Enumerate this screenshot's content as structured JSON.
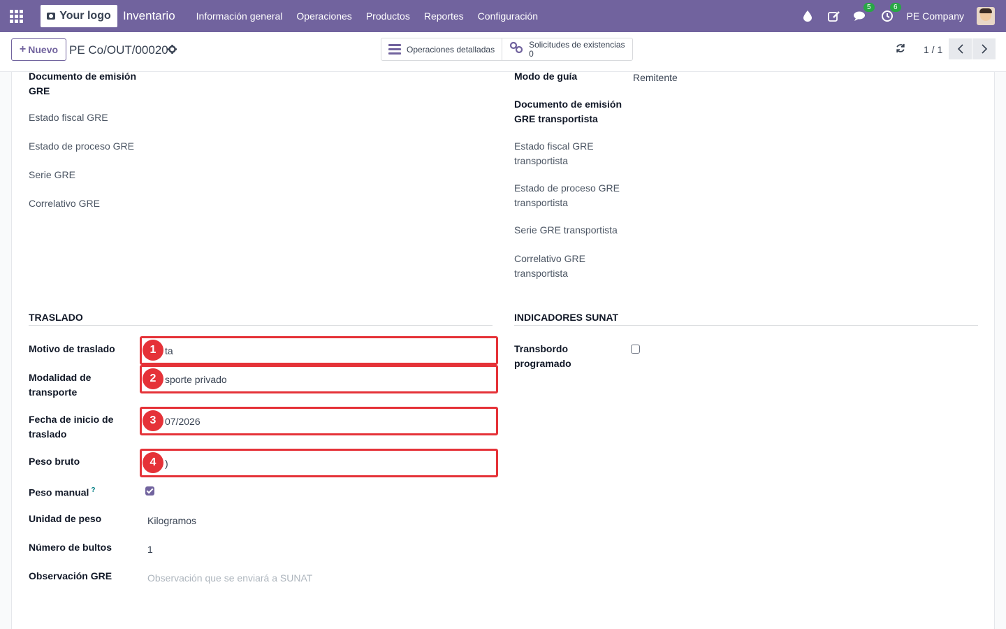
{
  "navbar": {
    "logo_text": "Your logo",
    "app_name": "Inventario",
    "menu": [
      "Información general",
      "Operaciones",
      "Productos",
      "Reportes",
      "Configuración"
    ],
    "messages_badge": "5",
    "activities_badge": "6",
    "company": "PE Company"
  },
  "control": {
    "new_label": "Nuevo",
    "record_name": "PE Co/OUT/00020",
    "smart_detailed": "Operaciones detalladas",
    "smart_requests_label": "Solicitudes de existencias",
    "smart_requests_count": "0",
    "pager": "1 / 1"
  },
  "left_fields": {
    "doc_emision_1": "Documento de emisión",
    "doc_emision_2": "GRE",
    "estado_fiscal": "Estado fiscal GRE",
    "estado_proceso": "Estado de proceso GRE",
    "serie": "Serie GRE",
    "correlativo": "Correlativo GRE"
  },
  "right_fields": {
    "modo_guia": "Modo de guía",
    "modo_guia_value": "Remitente",
    "doc_trans_1": "Documento de emisión",
    "doc_trans_2": "GRE transportista",
    "estado_fiscal_1": "Estado fiscal GRE",
    "estado_fiscal_2": "transportista",
    "estado_proceso_1": "Estado de proceso GRE",
    "estado_proceso_2": "transportista",
    "serie_trans": "Serie GRE transportista",
    "correlativo_1": "Correlativo GRE",
    "correlativo_2": "transportista"
  },
  "traslado": {
    "section": "TRASLADO",
    "motivo_label": "Motivo de traslado",
    "motivo_value": "ta",
    "modalidad_1": "Modalidad de",
    "modalidad_2": "transporte",
    "modalidad_value": "sporte privado",
    "fecha_1": "Fecha de inicio de",
    "fecha_2": "traslado",
    "fecha_value": "07/2026",
    "peso_bruto_label": "Peso bruto",
    "peso_bruto_value": ")",
    "peso_manual_label": "Peso manual",
    "peso_manual_help": "?",
    "unidad_label": "Unidad de peso",
    "unidad_value": "Kilogramos",
    "bultos_label": "Número de bultos",
    "bultos_value": "1",
    "observacion_label": "Observación GRE",
    "observacion_placeholder": "Observación que se enviará a SUNAT"
  },
  "indicadores": {
    "section": "INDICADORES SUNAT",
    "transbordo_1": "Transbordo",
    "transbordo_2": "programado"
  },
  "annotations": [
    "1",
    "2",
    "3",
    "4"
  ],
  "colors": {
    "brand": "#71639e",
    "highlight": "#e53238",
    "badge": "#28a745"
  }
}
